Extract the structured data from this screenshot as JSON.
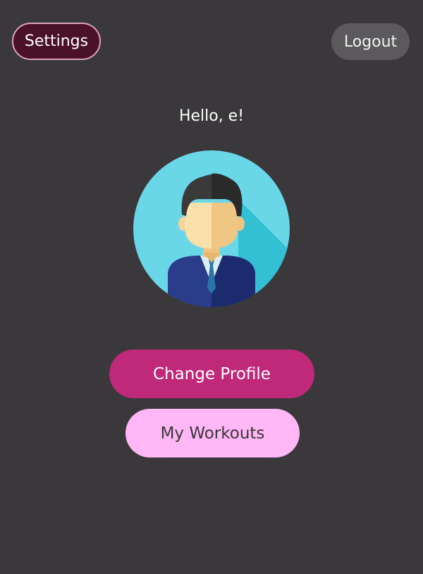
{
  "header": {
    "settings_label": "Settings",
    "logout_label": "Logout"
  },
  "profile": {
    "greeting": "Hello, e!",
    "avatar_icon": "user-avatar-icon"
  },
  "actions": {
    "change_profile_label": "Change Profile",
    "my_workouts_label": "My Workouts"
  },
  "colors": {
    "background": "#3a383b",
    "settings_bg": "#4a1128",
    "logout_bg": "#5b595c",
    "change_profile_bg": "#c0287a",
    "my_workouts_bg": "#ffb7f5",
    "avatar_circle": "#6ad7e9"
  }
}
